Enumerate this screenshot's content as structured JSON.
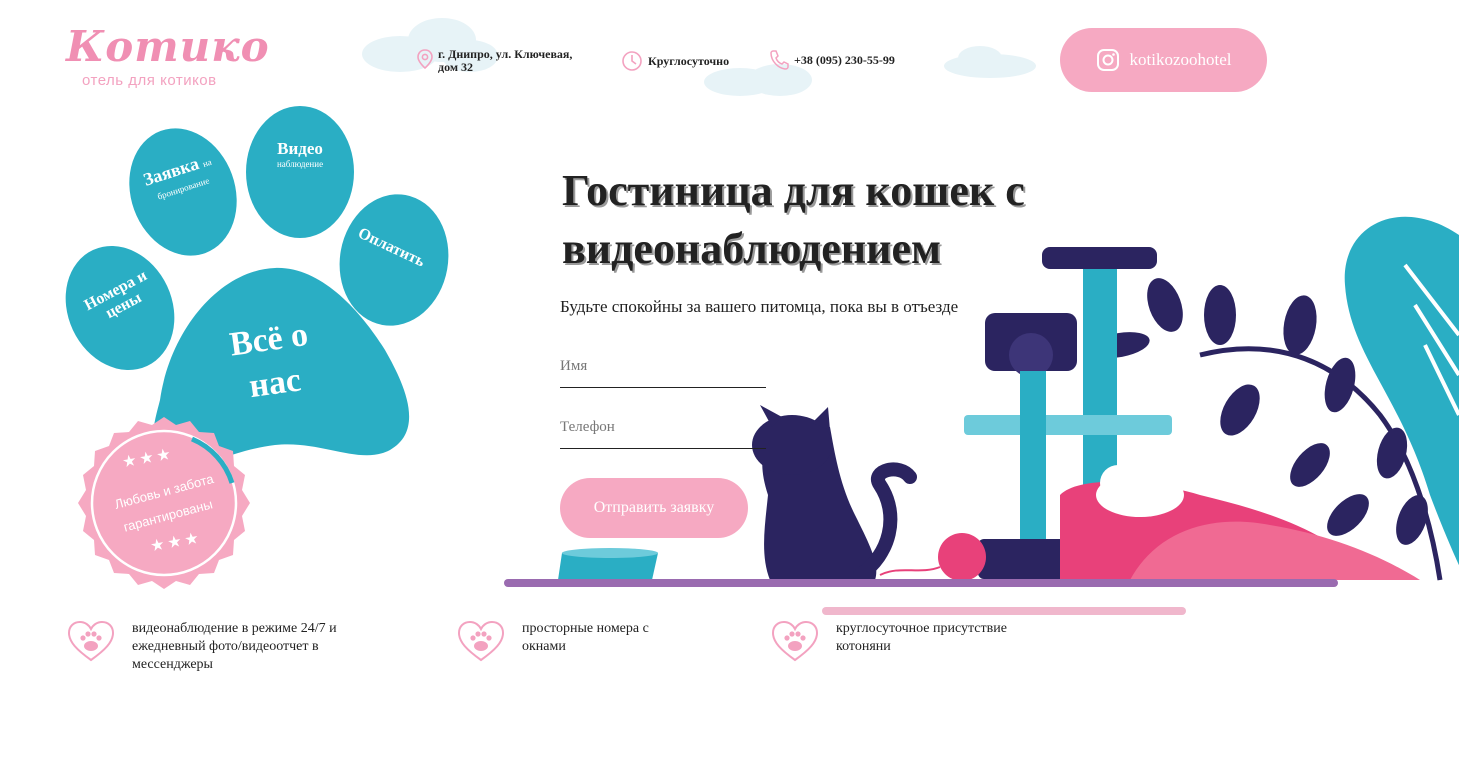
{
  "logo": {
    "title": "Котико",
    "subtitle": "отель для котиков"
  },
  "header": {
    "address": "г. Днипро, ул. Ключевая, дом 32",
    "hours": "Круглосуточно",
    "phone": "+38 (095) 230-55-99",
    "instagram": "kotikozoohotel"
  },
  "paw": {
    "request_main": "Заявка",
    "request_small": "на бронирование",
    "video_main": "Видео",
    "video_small": "наблюдение",
    "pay": "Оплатить",
    "rooms": "Номера и цены",
    "about": "Всё о нас"
  },
  "badge": {
    "text_line1": "Любовь и забота",
    "text_line2": "гарантированы",
    "stars": "★★★"
  },
  "hero": {
    "title": "Гостиница для кошек с видеонаблюдением",
    "subtitle": "Будьте спокойны за вашего питомца, пока вы в отъезде"
  },
  "form": {
    "name_placeholder": "Имя",
    "phone_placeholder": "Телефон",
    "submit_label": "Отправить заявку"
  },
  "features": [
    {
      "text": "видеонаблюдение в режиме 24/7 и ежедневный фото/видеоотчет в мессенджеры"
    },
    {
      "text": "просторные номера с окнами"
    },
    {
      "text": "круглосуточное присутствие котоняни"
    }
  ],
  "colors": {
    "pink": "#f6a9c2",
    "teal": "#2aaec4",
    "navy": "#2b2460",
    "magenta": "#e8417a"
  }
}
